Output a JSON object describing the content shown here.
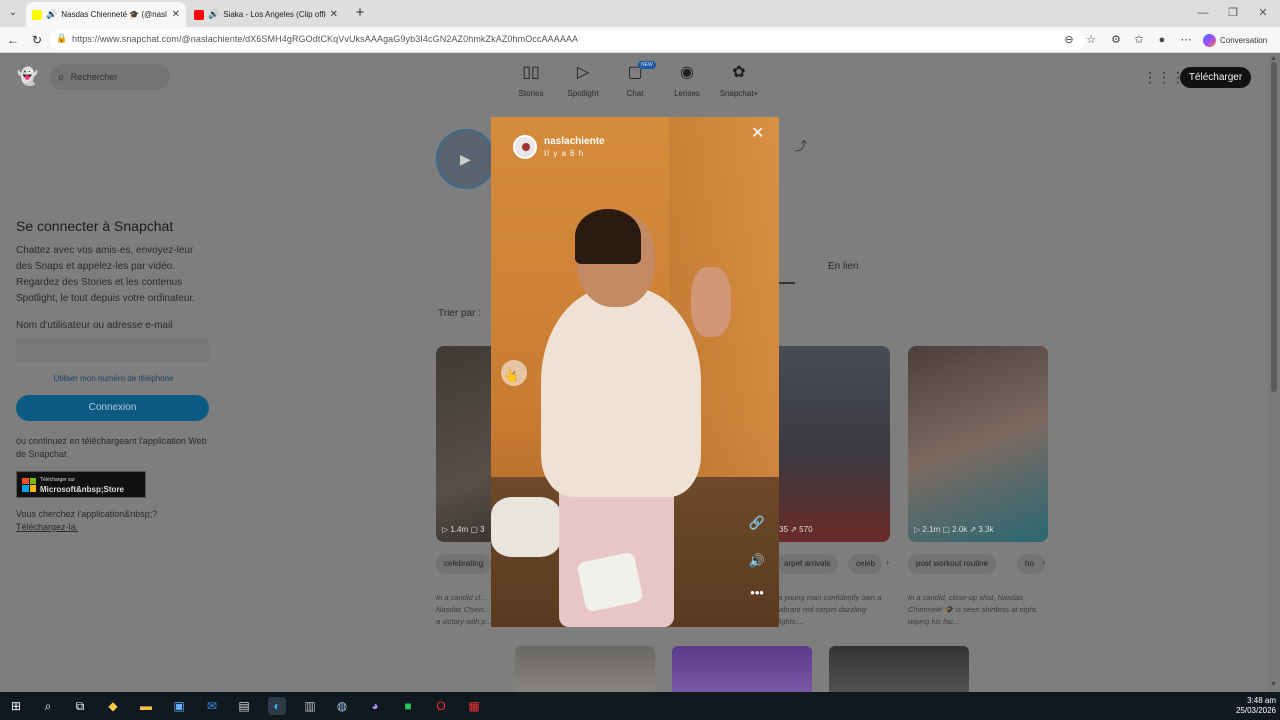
{
  "browser": {
    "tabs": [
      {
        "title": "Nasdas Chienneté 🎓 (@nasl",
        "active": true,
        "favicon_color": "#fffc00",
        "audio": true
      },
      {
        "title": "Siaka - Los Angeles (Clip offic",
        "active": false,
        "favicon_color": "#ff0000",
        "audio": true
      }
    ],
    "url": "https://www.snapchat.com/@naslachiente/dX6SMH4gRGOdtCKqVvUksAAAgaG9yb3I4cGN2AZ0hmkZkAZ0hmOccAAAAAA",
    "copilot_label": "Conversation"
  },
  "page": {
    "search_placeholder": "Rechercher",
    "nav": [
      {
        "label": "Stories",
        "icon": "stories-icon",
        "glyph": "▯▯"
      },
      {
        "label": "Spotlight",
        "icon": "spotlight-icon",
        "glyph": "▷"
      },
      {
        "label": "Chat",
        "icon": "chat-icon",
        "glyph": "▢",
        "badge": "NEW"
      },
      {
        "label": "Lenses",
        "icon": "lenses-icon",
        "glyph": "◉"
      },
      {
        "label": "Snapchat+",
        "icon": "snapchat-plus-icon",
        "glyph": "✿"
      }
    ],
    "download_label": "Télécharger",
    "login": {
      "title": "Se connecter à Snapchat",
      "description": "Chattez avec vos amis·es, envoyez-leur des Snaps et appelez-les par vidéo. Regardez des Stories et les contenus Spotlight, le tout depuis votre ordinateur.",
      "field_label": "Nom d'utilisateur ou adresse e-mail",
      "phone_link": "Utiliser mon numéro de téléphone",
      "submit": "Connexion",
      "alt_text": "ou continuez en téléchargeant l'application Web de Snapchat",
      "store_small": "Télécharger sur",
      "store_big": "Microsoft&nbsp;Store",
      "looking_prefix": "Vous cherchez l'application&nbsp;? ",
      "looking_link": "Téléchargez-la."
    },
    "tab_online": "En lien",
    "sort_label": "Trier par :",
    "cards": [
      {
        "stats": "▷ 1.4m  ▢ 3",
        "chip": "celebrating",
        "caption": "In a candid cl... Nasdas Chien... a victory with p..."
      },
      {
        "stats": "m  ▢ 635  ⇗ 570",
        "chip": "arpet arrivals",
        "chip2": "celeb",
        "caption": "a young man confidently own a vibrant red carpet dazzling lights,..."
      },
      {
        "stats": "▷ 2.1m  ▢ 2.0k  ⇗ 3.3k",
        "chip": "post workout routine",
        "chip2": "ho",
        "caption": "In a candid, close-up shot, Nasdas Chienneté 🎓 is seen shirtless at night, wiping his fac..."
      }
    ]
  },
  "story": {
    "username": "naslachiente",
    "time": "Il y a 6 h"
  },
  "taskbar": {
    "time": "3:48 am",
    "date": "25/03/2026"
  }
}
